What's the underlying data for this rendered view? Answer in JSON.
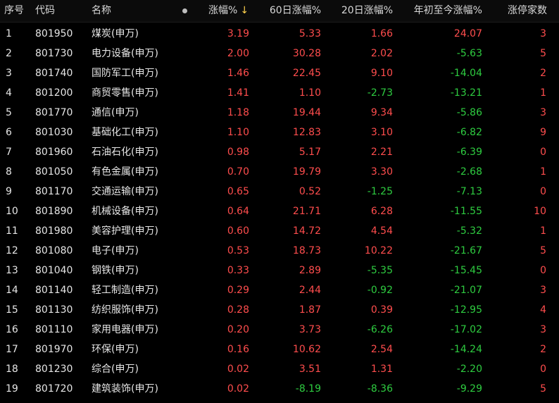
{
  "headers": {
    "seq": "序号",
    "code": "代码",
    "name": "名称",
    "chg": "涨幅%",
    "chg60": "60日涨幅%",
    "chg20": "20日涨幅%",
    "ytd": "年初至今涨幅%",
    "limitup": "涨停家数"
  },
  "sort_arrow": "↓",
  "rows": [
    {
      "seq": "1",
      "code": "801950",
      "name": "煤炭(申万)",
      "chg": "3.19",
      "chg60": "5.33",
      "chg20": "1.66",
      "ytd": "24.07",
      "limitup": "3"
    },
    {
      "seq": "2",
      "code": "801730",
      "name": "电力设备(申万)",
      "chg": "2.00",
      "chg60": "30.28",
      "chg20": "2.02",
      "ytd": "-5.63",
      "limitup": "5"
    },
    {
      "seq": "3",
      "code": "801740",
      "name": "国防军工(申万)",
      "chg": "1.46",
      "chg60": "22.45",
      "chg20": "9.10",
      "ytd": "-14.04",
      "limitup": "2"
    },
    {
      "seq": "4",
      "code": "801200",
      "name": "商贸零售(申万)",
      "chg": "1.41",
      "chg60": "1.10",
      "chg20": "-2.73",
      "ytd": "-13.21",
      "limitup": "1"
    },
    {
      "seq": "5",
      "code": "801770",
      "name": "通信(申万)",
      "chg": "1.18",
      "chg60": "19.44",
      "chg20": "9.34",
      "ytd": "-5.86",
      "limitup": "3"
    },
    {
      "seq": "6",
      "code": "801030",
      "name": "基础化工(申万)",
      "chg": "1.10",
      "chg60": "12.83",
      "chg20": "3.10",
      "ytd": "-6.82",
      "limitup": "9"
    },
    {
      "seq": "7",
      "code": "801960",
      "name": "石油石化(申万)",
      "chg": "0.98",
      "chg60": "5.17",
      "chg20": "2.21",
      "ytd": "-6.39",
      "limitup": "0"
    },
    {
      "seq": "8",
      "code": "801050",
      "name": "有色金属(申万)",
      "chg": "0.70",
      "chg60": "19.79",
      "chg20": "3.30",
      "ytd": "-2.68",
      "limitup": "1"
    },
    {
      "seq": "9",
      "code": "801170",
      "name": "交通运输(申万)",
      "chg": "0.65",
      "chg60": "0.52",
      "chg20": "-1.25",
      "ytd": "-7.13",
      "limitup": "0"
    },
    {
      "seq": "10",
      "code": "801890",
      "name": "机械设备(申万)",
      "chg": "0.64",
      "chg60": "21.71",
      "chg20": "6.28",
      "ytd": "-11.55",
      "limitup": "10"
    },
    {
      "seq": "11",
      "code": "801980",
      "name": "美容护理(申万)",
      "chg": "0.60",
      "chg60": "14.72",
      "chg20": "4.54",
      "ytd": "-5.32",
      "limitup": "1"
    },
    {
      "seq": "12",
      "code": "801080",
      "name": "电子(申万)",
      "chg": "0.53",
      "chg60": "18.73",
      "chg20": "10.22",
      "ytd": "-21.67",
      "limitup": "5"
    },
    {
      "seq": "13",
      "code": "801040",
      "name": "钢铁(申万)",
      "chg": "0.33",
      "chg60": "2.89",
      "chg20": "-5.35",
      "ytd": "-15.45",
      "limitup": "0"
    },
    {
      "seq": "14",
      "code": "801140",
      "name": "轻工制造(申万)",
      "chg": "0.29",
      "chg60": "2.44",
      "chg20": "-0.92",
      "ytd": "-21.07",
      "limitup": "3"
    },
    {
      "seq": "15",
      "code": "801130",
      "name": "纺织服饰(申万)",
      "chg": "0.28",
      "chg60": "1.87",
      "chg20": "0.39",
      "ytd": "-12.95",
      "limitup": "4"
    },
    {
      "seq": "16",
      "code": "801110",
      "name": "家用电器(申万)",
      "chg": "0.20",
      "chg60": "3.73",
      "chg20": "-6.26",
      "ytd": "-17.02",
      "limitup": "3"
    },
    {
      "seq": "17",
      "code": "801970",
      "name": "环保(申万)",
      "chg": "0.16",
      "chg60": "10.62",
      "chg20": "2.54",
      "ytd": "-14.24",
      "limitup": "2"
    },
    {
      "seq": "18",
      "code": "801230",
      "name": "综合(申万)",
      "chg": "0.02",
      "chg60": "3.51",
      "chg20": "1.31",
      "ytd": "-2.20",
      "limitup": "0"
    },
    {
      "seq": "19",
      "code": "801720",
      "name": "建筑装饰(申万)",
      "chg": "0.02",
      "chg60": "-8.19",
      "chg20": "-8.36",
      "ytd": "-9.29",
      "limitup": "5"
    }
  ],
  "colors": {
    "up": "#ff4d4d",
    "down": "#2ecc40",
    "sort_arrow": "#ffd24d",
    "background": "#000000"
  }
}
